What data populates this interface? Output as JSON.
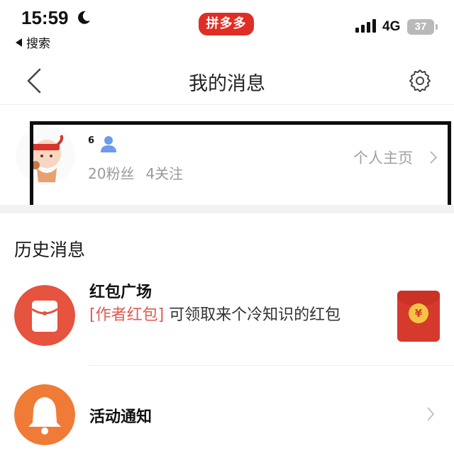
{
  "status_bar": {
    "time": "15:59",
    "back_app_label": "搜索",
    "brand_label": "拼多多",
    "network": "4G",
    "battery": "37"
  },
  "header": {
    "title": "我的消息"
  },
  "profile": {
    "username": "6",
    "followers": "20粉丝",
    "following": "4关注",
    "homepage_label": "个人主页"
  },
  "history": {
    "section_title": "历史消息",
    "items": [
      {
        "title": "红包广场",
        "tag": "[作者红包]",
        "body": " 可领取来个冷知识的红包",
        "thumb_symbol": "¥",
        "icon": "red-envelope-icon",
        "icon_color": "#e6533f"
      },
      {
        "title": "活动通知",
        "icon": "bell-icon",
        "icon_color": "#f07b36"
      }
    ]
  },
  "colors": {
    "brand": "#e02e24",
    "tag": "#e05a4f",
    "muted": "#9a9a9a"
  }
}
